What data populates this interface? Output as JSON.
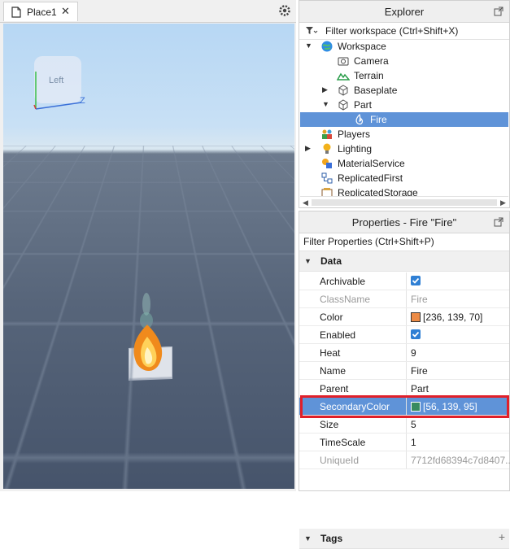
{
  "tabs": [
    {
      "title": "Place1",
      "close": "✕"
    }
  ],
  "viewport": {
    "view_cube_face": "Left",
    "axis_z": "Z"
  },
  "explorer": {
    "title": "Explorer",
    "filter_placeholder": "Filter workspace (Ctrl+Shift+X)",
    "items": [
      {
        "label": "Workspace",
        "expanded": true,
        "icon": "workspace-globe-icon"
      },
      {
        "label": "Camera",
        "icon": "camera-icon"
      },
      {
        "label": "Terrain",
        "icon": "terrain-icon"
      },
      {
        "label": "Baseplate",
        "icon": "part-cube-icon"
      },
      {
        "label": "Part",
        "expanded": true,
        "icon": "part-cube-icon"
      },
      {
        "label": "Fire",
        "selected": true,
        "icon": "fire-icon"
      },
      {
        "label": "Players",
        "icon": "players-icon"
      },
      {
        "label": "Lighting",
        "icon": "lighting-bulb-icon"
      },
      {
        "label": "MaterialService",
        "icon": "material-service-icon"
      },
      {
        "label": "ReplicatedFirst",
        "icon": "replicated-first-icon"
      },
      {
        "label": "ReplicatedStorage",
        "icon": "replicated-storage-icon"
      }
    ]
  },
  "properties": {
    "title": "Properties - Fire \"Fire\"",
    "filter_placeholder": "Filter Properties (Ctrl+Shift+P)",
    "sections": [
      "Data",
      "Tags"
    ],
    "rows": [
      {
        "name": "Archivable",
        "value": "",
        "type": "checkbox",
        "checked": true
      },
      {
        "name": "ClassName",
        "value": "Fire",
        "dim": true
      },
      {
        "name": "Color",
        "value": "[236, 139, 70]",
        "swatch": "#ec8b46"
      },
      {
        "name": "Enabled",
        "value": "",
        "type": "checkbox",
        "checked": true
      },
      {
        "name": "Heat",
        "value": "9"
      },
      {
        "name": "Name",
        "value": "Fire"
      },
      {
        "name": "Parent",
        "value": "Part"
      },
      {
        "name": "SecondaryColor",
        "value": "[56, 139, 95]",
        "swatch": "#388b5f",
        "selected": true
      },
      {
        "name": "Size",
        "value": "5"
      },
      {
        "name": "TimeScale",
        "value": "1"
      },
      {
        "name": "UniqueId",
        "value": "7712fd68394c7d8407...",
        "dim": true
      }
    ]
  },
  "colors": {
    "selection": "#5f93d8",
    "highlight_border": "#e0202a",
    "checkbox": "#2f7fd4"
  }
}
